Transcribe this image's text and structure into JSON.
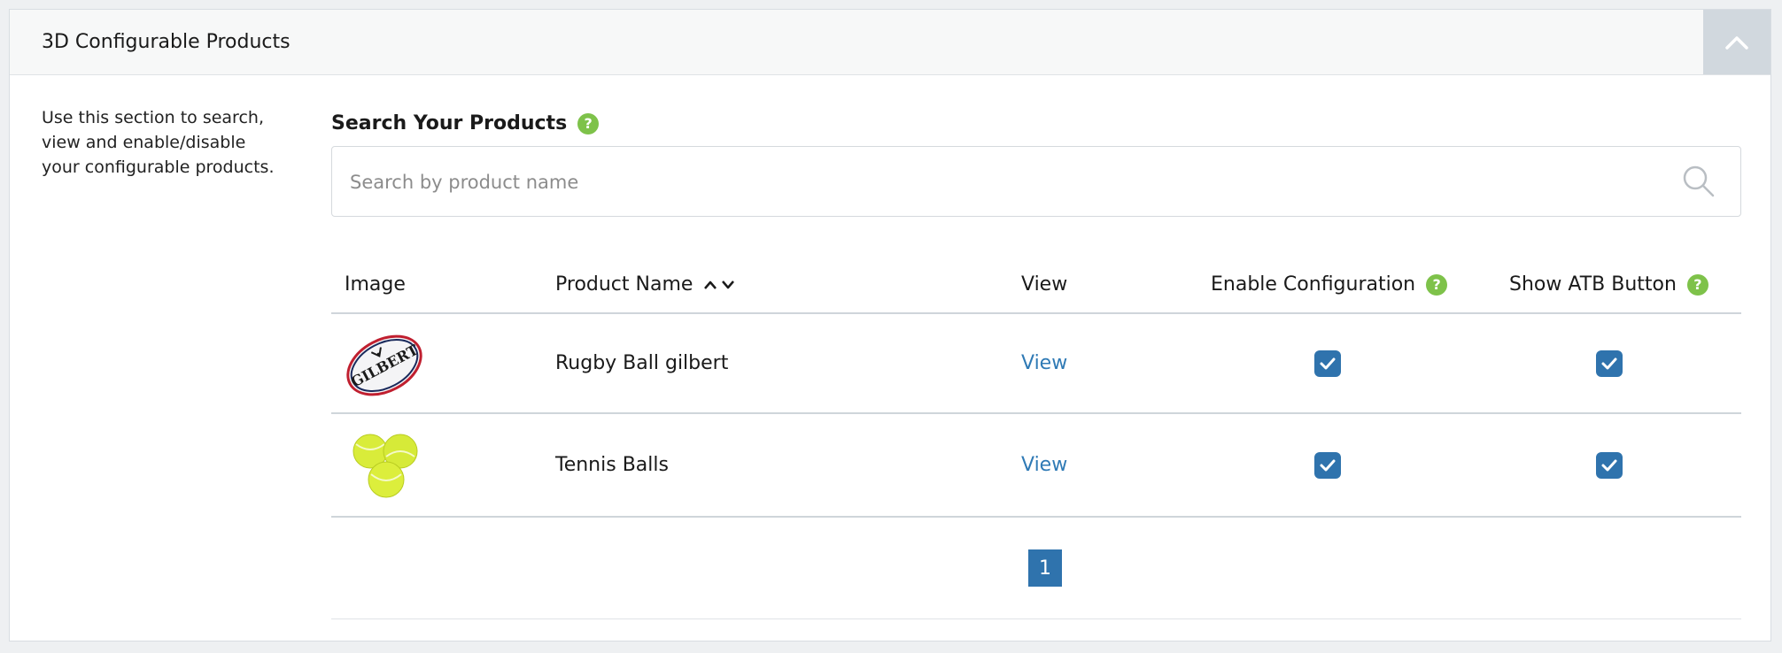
{
  "panel": {
    "title": "3D Configurable Products",
    "description": "Use this section to search, view and enable/disable your configurable products."
  },
  "search": {
    "label": "Search Your Products",
    "placeholder": "Search by product name",
    "value": ""
  },
  "table": {
    "headers": {
      "image": "Image",
      "product_name": "Product Name",
      "view": "View",
      "enable_configuration": "Enable Configuration",
      "show_atb_button": "Show ATB Button"
    },
    "rows": [
      {
        "name": "Rugby Ball gilbert",
        "image_icon": "rugby-ball-icon",
        "image_text": "GILBERT",
        "view_label": "View",
        "enable_configuration": true,
        "show_atb_button": true
      },
      {
        "name": "Tennis Balls",
        "image_icon": "tennis-balls-icon",
        "view_label": "View",
        "enable_configuration": true,
        "show_atb_button": true
      }
    ]
  },
  "pagination": {
    "current_page": "1"
  },
  "icons": {
    "help": "?"
  },
  "colors": {
    "accent_blue": "#2f73ad",
    "link_blue": "#2f7ab5",
    "help_green": "#7ec24a",
    "header_bg": "#f7f8f8",
    "collapse_bg": "#d1d8de"
  }
}
